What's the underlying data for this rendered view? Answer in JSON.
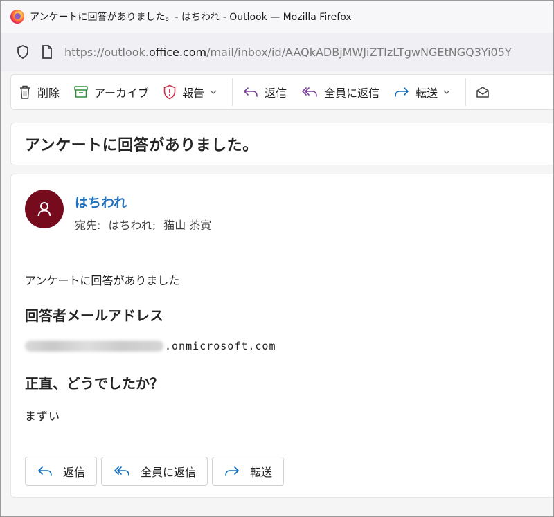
{
  "window": {
    "title": "アンケートに回答がありました。- はちわれ - Outlook — Mozilla Firefox"
  },
  "urlbar": {
    "prefix": "https://outlook.",
    "domain": "office.com",
    "path": "/mail/inbox/id/AAQkADBjMWJiZTIzLTgwNGEtNGQ3Yi05Y"
  },
  "toolbar": {
    "delete_label": "削除",
    "archive_label": "アーカイブ",
    "report_label": "報告",
    "reply_label": "返信",
    "reply_all_label": "全員に返信",
    "forward_label": "転送"
  },
  "message": {
    "subject": "アンケートに回答がありました。",
    "sender": "はちわれ",
    "to_label": "宛先:",
    "recipients": [
      "はちわれ;",
      "猫山 茶寅"
    ],
    "body_intro": "アンケートに回答がありました",
    "q1_heading": "回答者メールアドレス",
    "email_domain": ".onmicrosoft.com",
    "q2_heading": "正直、どうでしたか？",
    "answer": "まずい"
  },
  "actions": {
    "reply_label": "返信",
    "reply_all_label": "全員に返信",
    "forward_label": "転送"
  },
  "colors": {
    "avatar_bg": "#750b1c",
    "sender_link": "#1f6fbf",
    "accent_icon": "#0f6cbd"
  }
}
